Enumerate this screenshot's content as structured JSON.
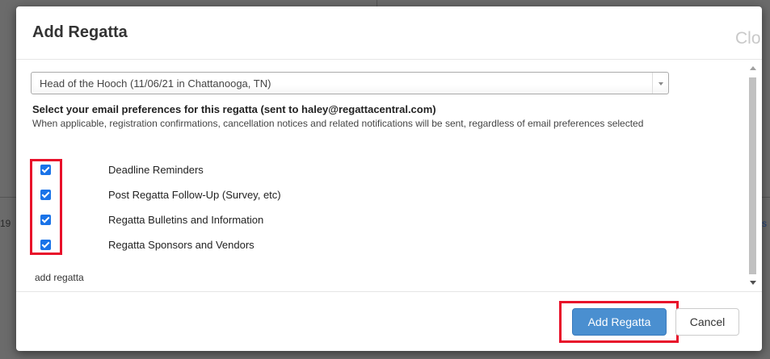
{
  "background": {
    "left_fragment": "19",
    "right_fragment": "s"
  },
  "modal": {
    "title": "Add Regatta",
    "close_label": "Clo",
    "regatta_select": {
      "selected": "Head of the Hooch (11/06/21 in Chattanooga, TN)"
    },
    "preferences_heading": "Select your email preferences for this regatta (sent to haley@regattacentral.com)",
    "preferences_note": "When applicable, registration confirmations, cancellation notices and related notifications will be sent, regardless of email preferences selected",
    "preferences": [
      {
        "label": "Deadline Reminders",
        "checked": true
      },
      {
        "label": "Post Regatta Follow-Up (Survey, etc)",
        "checked": true
      },
      {
        "label": "Regatta Bulletins and Information",
        "checked": true
      },
      {
        "label": "Regatta Sponsors and Vendors",
        "checked": true
      }
    ],
    "add_regatta_link": "add regatta",
    "footer": {
      "primary_button": "Add Regatta",
      "cancel_button": "Cancel"
    }
  },
  "colors": {
    "checkbox": "#1a73e8",
    "primary_button": "#4a8fd0",
    "highlight": "#e8102a",
    "backdrop": "#6b6b6b"
  }
}
